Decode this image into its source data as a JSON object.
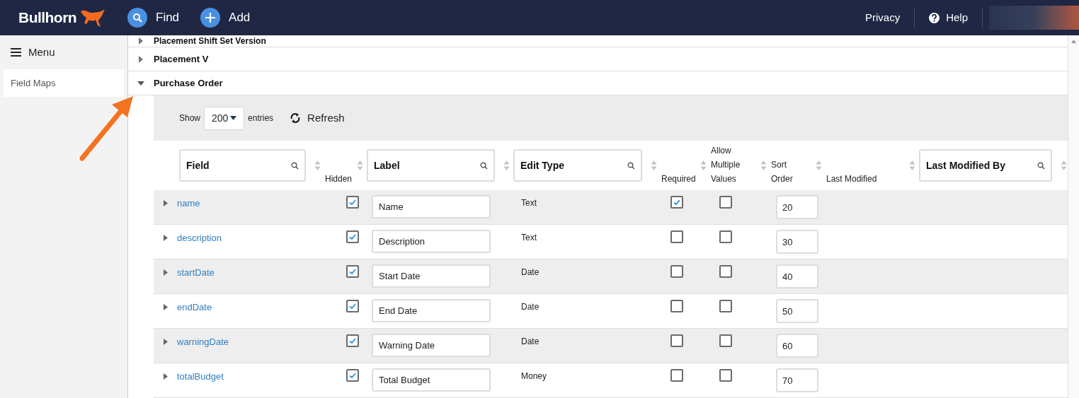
{
  "header": {
    "logo": "Bullhorn",
    "actions": [
      {
        "label": "Find",
        "kind": "search"
      },
      {
        "label": "Add",
        "kind": "add"
      }
    ],
    "links": [
      {
        "label": "Privacy",
        "kind": "link"
      },
      {
        "label": "Help",
        "kind": "help"
      }
    ]
  },
  "sidebar": {
    "menu": "Menu",
    "items": [
      {
        "label": "Field Maps",
        "selected": true
      }
    ]
  },
  "sections": [
    {
      "title": "Placement Shift Set Version",
      "expanded": false
    },
    {
      "title": "Placement V",
      "expanded": false
    },
    {
      "title": "Purchase Order",
      "expanded": true
    }
  ],
  "table": {
    "show_label": "Show",
    "entries_value": "200",
    "entries_label": "entries",
    "refresh": "Refresh",
    "columns": [
      {
        "label": "Field",
        "kind": "search"
      },
      {
        "label": "Hidden",
        "kind": "plain"
      },
      {
        "label": "Label",
        "kind": "search"
      },
      {
        "label": "Edit Type",
        "kind": "search"
      },
      {
        "label": "Required",
        "kind": "plain"
      },
      {
        "label": "Allow Multiple Values",
        "kind": "plain"
      },
      {
        "label": "Sort Order",
        "kind": "plain"
      },
      {
        "label": "Last Modified",
        "kind": "plain"
      },
      {
        "label": "Last Modified By",
        "kind": "search"
      }
    ],
    "rows": [
      {
        "field": "name",
        "hidden": true,
        "label": "Name",
        "edit_type": "Text",
        "required": true,
        "allow_multiple": false,
        "sort_order": "20"
      },
      {
        "field": "description",
        "hidden": true,
        "label": "Description",
        "edit_type": "Text",
        "required": false,
        "allow_multiple": false,
        "sort_order": "30"
      },
      {
        "field": "startDate",
        "hidden": true,
        "label": "Start Date",
        "edit_type": "Date",
        "required": false,
        "allow_multiple": false,
        "sort_order": "40"
      },
      {
        "field": "endDate",
        "hidden": true,
        "label": "End Date",
        "edit_type": "Date",
        "required": false,
        "allow_multiple": false,
        "sort_order": "50"
      },
      {
        "field": "warningDate",
        "hidden": true,
        "label": "Warning Date",
        "edit_type": "Date",
        "required": false,
        "allow_multiple": false,
        "sort_order": "60"
      },
      {
        "field": "totalBudget",
        "hidden": true,
        "label": "Total Budget",
        "edit_type": "Money",
        "required": false,
        "allow_multiple": false,
        "sort_order": "70"
      }
    ]
  }
}
